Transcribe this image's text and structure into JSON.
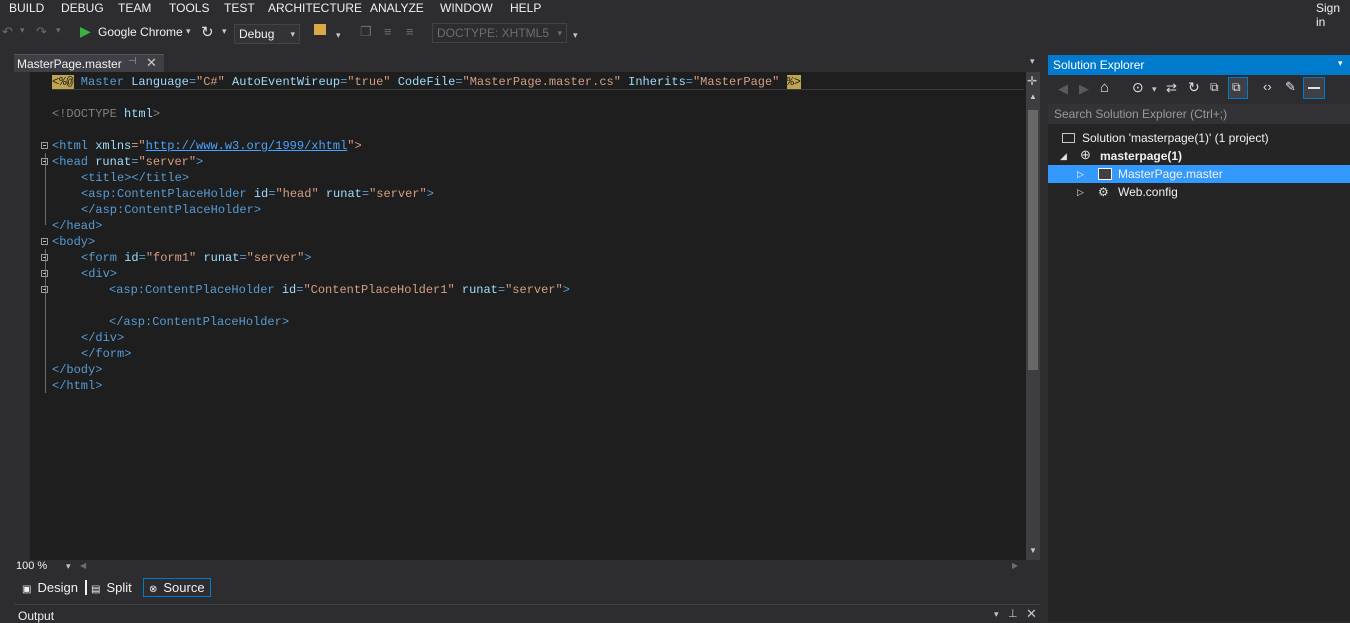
{
  "menu": {
    "items": [
      "BUILD",
      "DEBUG",
      "TEAM",
      "TOOLS",
      "TEST",
      "ARCHITECTURE",
      "ANALYZE",
      "WINDOW",
      "HELP"
    ],
    "sign_in": "Sign in"
  },
  "toolbar": {
    "run_target": "Google Chrome",
    "configuration": "Debug",
    "doctype": "DOCTYPE: XHTML5"
  },
  "editor": {
    "tab_label": "MasterPage.master",
    "zoom": "100 %",
    "views": [
      "Design",
      "Split",
      "Source"
    ],
    "active_view": "Source",
    "lines": {
      "l1": {
        "open": "<%@",
        "directive": " Master ",
        "a1": "Language",
        "v1": "\"C#\"",
        "a2": "AutoEventWireup",
        "v2": "\"true\"",
        "a3": "CodeFile",
        "v3": "\"MasterPage.master.cs\"",
        "a4": "Inherits",
        "v4": "\"MasterPage\"",
        "close": "%>"
      },
      "l2": {
        "lt": "<!",
        "name": "DOCTYPE",
        "rest": " html",
        "gt": ">"
      },
      "l3": {
        "open": "<html ",
        "attr": "xmlns",
        "eq": "=\"",
        "link": "http://www.w3.org/1999/xhtml",
        "close": "\">"
      },
      "l4": {
        "open": "<head ",
        "attr": "runat",
        "val": "\"server\"",
        "close": ">"
      },
      "l5": {
        "text": "<title></title>"
      },
      "l6": {
        "open": "<asp:ContentPlaceHolder ",
        "a1": "id",
        "v1": "\"head\"",
        "a2": "runat",
        "v2": "\"server\"",
        "close": ">"
      },
      "l7": {
        "text": "</asp:ContentPlaceHolder>"
      },
      "l8": {
        "text": "</head>"
      },
      "l9": {
        "text": "<body>"
      },
      "l10": {
        "open": "<form ",
        "a1": "id",
        "v1": "\"form1\"",
        "a2": "runat",
        "v2": "\"server\"",
        "close": ">"
      },
      "l11": {
        "text": "<div>"
      },
      "l12": {
        "open": "<asp:ContentPlaceHolder ",
        "a1": "id",
        "v1": "\"ContentPlaceHolder1\"",
        "a2": "runat",
        "v2": "\"server\"",
        "close": ">"
      },
      "l13": {
        "text": "</asp:ContentPlaceHolder>"
      },
      "l14": {
        "text": "</div>"
      },
      "l15": {
        "text": "</form>"
      },
      "l16": {
        "text": "</body>"
      },
      "l17": {
        "text": "</html>"
      }
    }
  },
  "output": {
    "title": "Output"
  },
  "solution_explorer": {
    "title": "Solution Explorer",
    "search_placeholder": "Search Solution Explorer (Ctrl+;)",
    "solution": "Solution 'masterpage(1)' (1 project)",
    "project": "masterpage(1)",
    "items": [
      "MasterPage.master",
      "Web.config"
    ],
    "selected": "MasterPage.master"
  },
  "colors": {
    "accent": "#007acc",
    "selection": "#3399ff",
    "editor_bg": "#1e1e1e",
    "chrome_bg": "#2d2d30"
  }
}
